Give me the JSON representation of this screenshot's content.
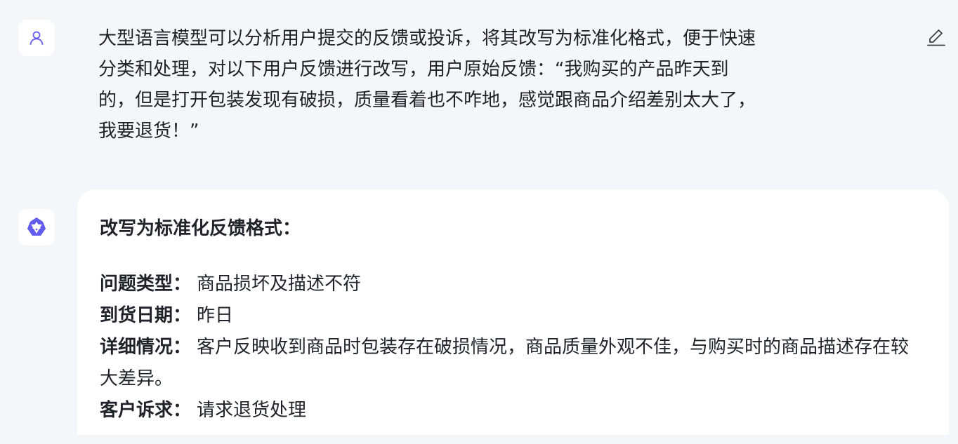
{
  "user_message": {
    "text": "大型语言模型可以分析用户提交的反馈或投诉，将其改写为标准化格式，便于快速分类和处理，对以下用户反馈进行改写，用户原始反馈：“我购买的产品昨天到的，但是打开包装发现有破损，质量看着也不咋地，感觉跟商品介绍差别太大了，我要退货！”",
    "lines": [
      "大型语言模型可以分析用户提交的反馈或投诉，将其改写为标准化格式，便于快速",
      "分类和处理，对以下用户反馈进行改写，用户原始反馈：“我购买的产品昨天到",
      "的，但是打开包装发现有破损，质量看着也不咋地，感觉跟商品介绍差别太大了，",
      "我要退货！”"
    ]
  },
  "ai_response": {
    "title": "改写为标准化反馈格式：",
    "fields": [
      {
        "label": "问题类型：",
        "value": "商品损坏及描述不符"
      },
      {
        "label": "到货日期：",
        "value": "昨日"
      },
      {
        "label": "详细情况：",
        "value": "客户反映收到商品时包装存在破损情况，商品质量外观不佳，与购买时的商品描述存在较大差异。"
      },
      {
        "label": "客户诉求：",
        "value": "请求退货处理"
      }
    ]
  },
  "icons": {
    "user_avatar": "user-icon",
    "ai_avatar": "ai-logo-icon",
    "edit": "pencil-icon"
  },
  "colors": {
    "background": "#f5f6fa",
    "card": "#ffffff",
    "accent": "#615ced",
    "text": "#1f2329"
  }
}
